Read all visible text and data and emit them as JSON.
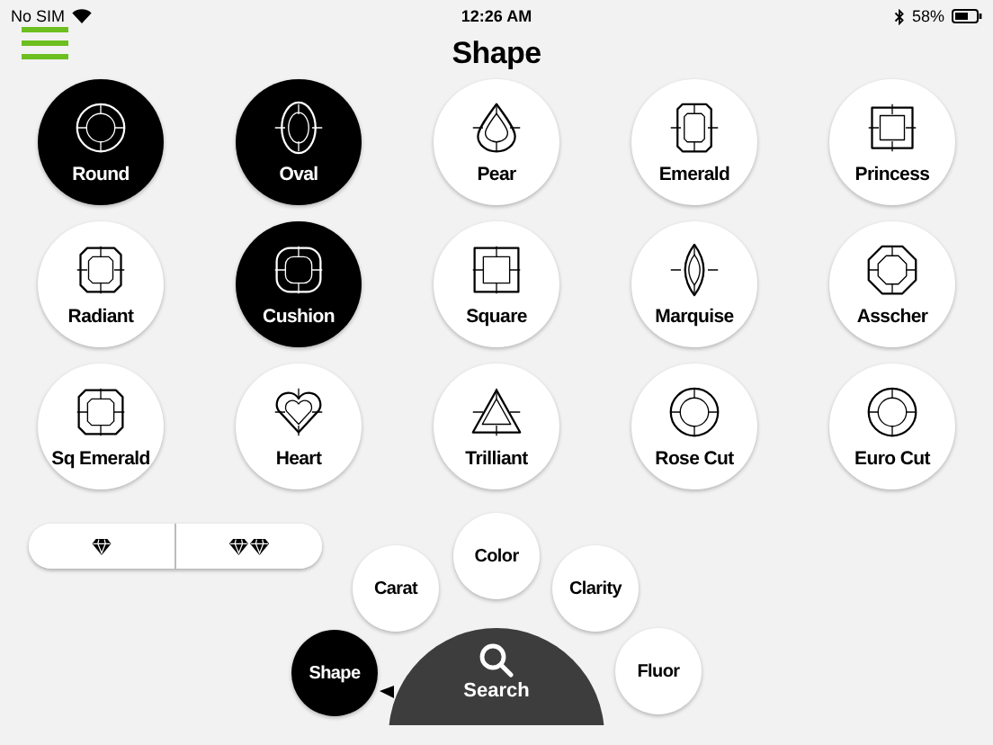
{
  "status_bar": {
    "carrier": "No SIM",
    "time": "12:26 AM",
    "battery": "58%"
  },
  "title": "Shape",
  "shapes": [
    {
      "label": "Round",
      "kind": "round",
      "selected": true
    },
    {
      "label": "Oval",
      "kind": "oval",
      "selected": true
    },
    {
      "label": "Pear",
      "kind": "pear",
      "selected": false
    },
    {
      "label": "Emerald",
      "kind": "emerald",
      "selected": false
    },
    {
      "label": "Princess",
      "kind": "princess",
      "selected": false
    },
    {
      "label": "Radiant",
      "kind": "radiant",
      "selected": false
    },
    {
      "label": "Cushion",
      "kind": "cushion",
      "selected": true
    },
    {
      "label": "Square",
      "kind": "square",
      "selected": false
    },
    {
      "label": "Marquise",
      "kind": "marquise",
      "selected": false
    },
    {
      "label": "Asscher",
      "kind": "asscher",
      "selected": false
    },
    {
      "label": "Sq Emerald",
      "kind": "sq_emerald",
      "selected": false
    },
    {
      "label": "Heart",
      "kind": "heart",
      "selected": false
    },
    {
      "label": "Trilliant",
      "kind": "trilliant",
      "selected": false
    },
    {
      "label": "Rose Cut",
      "kind": "rose_cut",
      "selected": false
    },
    {
      "label": "Euro Cut",
      "kind": "euro_cut",
      "selected": false
    }
  ],
  "size_toggle": [
    {
      "kind": "single"
    },
    {
      "kind": "pair"
    }
  ],
  "filters": [
    {
      "label": "Shape",
      "selected": true
    },
    {
      "label": "Carat",
      "selected": false
    },
    {
      "label": "Color",
      "selected": false
    },
    {
      "label": "Clarity",
      "selected": false
    },
    {
      "label": "Fluor",
      "selected": false
    }
  ],
  "search_button": {
    "label": "Search"
  }
}
